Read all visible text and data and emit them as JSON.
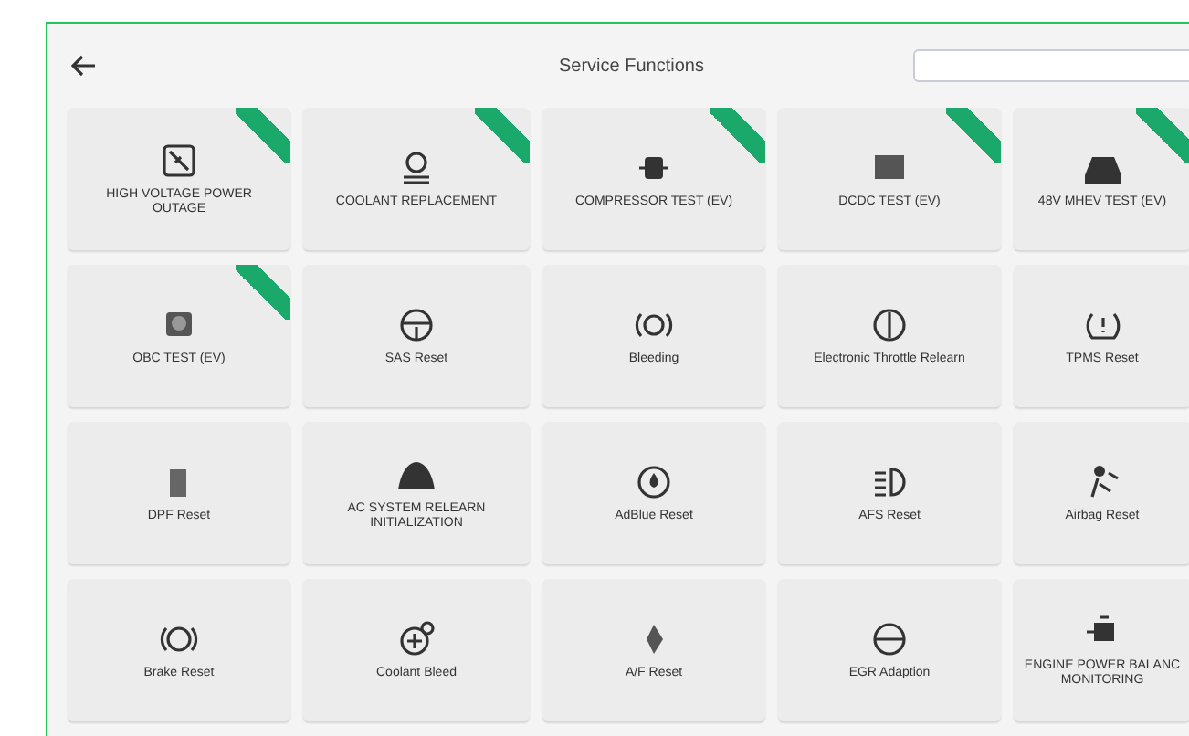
{
  "header": {
    "title": "Service Functions"
  },
  "tiles": [
    {
      "label": "HIGH VOLTAGE POWER OUTAGE",
      "new": true
    },
    {
      "label": "COOLANT REPLACEMENT",
      "new": true
    },
    {
      "label": "COMPRESSOR TEST (EV)",
      "new": true
    },
    {
      "label": "DCDC TEST (EV)",
      "new": true
    },
    {
      "label": "48V MHEV TEST (EV)",
      "new": true
    },
    {
      "label": "OBC TEST (EV)",
      "new": true
    },
    {
      "label": "SAS Reset",
      "new": false
    },
    {
      "label": "Bleeding",
      "new": false
    },
    {
      "label": "Electronic Throttle Relearn",
      "new": false
    },
    {
      "label": "TPMS Reset",
      "new": false
    },
    {
      "label": "DPF Reset",
      "new": false
    },
    {
      "label": "AC SYSTEM RELEARN INITIALIZATION",
      "new": false
    },
    {
      "label": "AdBlue Reset",
      "new": false
    },
    {
      "label": "AFS Reset",
      "new": false
    },
    {
      "label": "Airbag Reset",
      "new": false
    },
    {
      "label": "Brake Reset",
      "new": false
    },
    {
      "label": "Coolant Bleed",
      "new": false
    },
    {
      "label": "A/F Reset",
      "new": false
    },
    {
      "label": "EGR Adaption",
      "new": false
    },
    {
      "label": "ENGINE POWER BALANC MONITORING",
      "new": false
    }
  ]
}
